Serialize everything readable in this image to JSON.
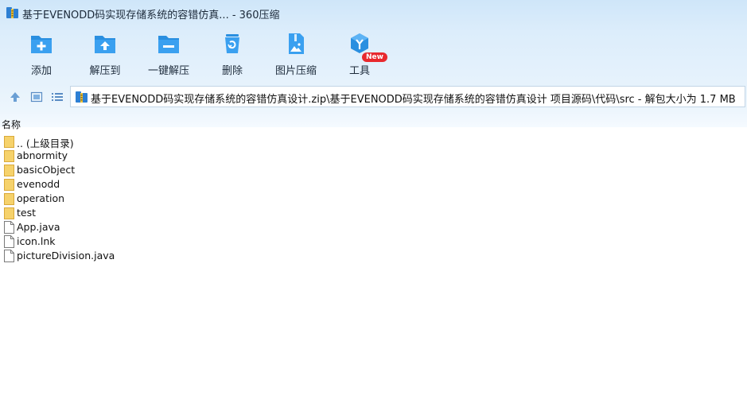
{
  "window": {
    "title": "基于EVENODD码实现存储系统的容错仿真... - 360压缩"
  },
  "toolbar": {
    "items": [
      {
        "label": "添加",
        "icon": "add-folder-icon"
      },
      {
        "label": "解压到",
        "icon": "extract-to-icon"
      },
      {
        "label": "一键解压",
        "icon": "one-click-extract-icon"
      },
      {
        "label": "删除",
        "icon": "recycle-delete-icon"
      },
      {
        "label": "图片压缩",
        "icon": "image-compress-icon"
      },
      {
        "label": "工具",
        "icon": "tools-cube-icon"
      }
    ],
    "badge": "New"
  },
  "address": {
    "path": "基于EVENODD码实现存储系统的容错仿真设计.zip\\基于EVENODD码实现存储系统的容错仿真设计 项目源码\\代码\\src - 解包大小为 1.7 MB"
  },
  "columns": {
    "name": "名称"
  },
  "files": [
    {
      "name": ".. (上级目录)",
      "type": "folder"
    },
    {
      "name": "abnormity",
      "type": "folder"
    },
    {
      "name": "basicObject",
      "type": "folder"
    },
    {
      "name": "evenodd",
      "type": "folder"
    },
    {
      "name": "operation",
      "type": "folder"
    },
    {
      "name": "test",
      "type": "folder"
    },
    {
      "name": "App.java",
      "type": "file"
    },
    {
      "name": "icon.lnk",
      "type": "file"
    },
    {
      "name": "pictureDivision.java",
      "type": "file"
    }
  ],
  "colors": {
    "accent": "#2a8fe0",
    "folder": "#f6d26b",
    "badge": "#e8292e"
  }
}
